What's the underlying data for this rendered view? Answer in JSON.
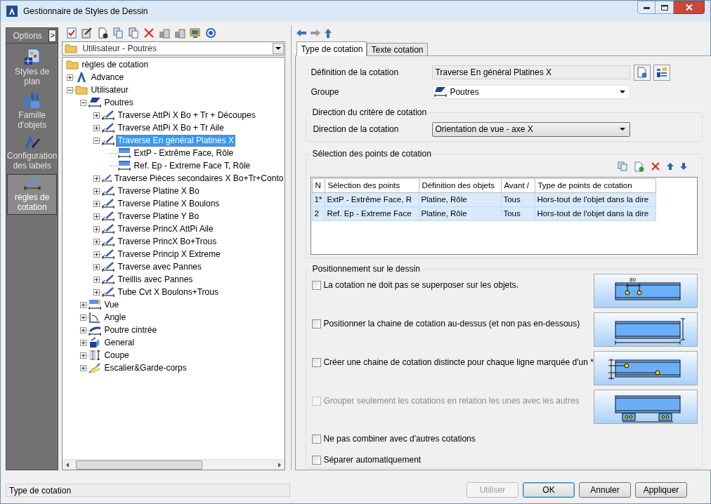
{
  "window": {
    "title": "Gestionnaire de Styles de Dessin"
  },
  "sidebar": {
    "header": "Options",
    "expand_button": ">",
    "items": [
      {
        "label": "Styles de plan",
        "kind": "plan",
        "selected": false
      },
      {
        "label": "Famille d'objets",
        "kind": "family",
        "selected": false
      },
      {
        "label": "Configuration des labels",
        "kind": "labels",
        "selected": false
      },
      {
        "label": "règles de cotation",
        "kind": "rules",
        "selected": true
      }
    ]
  },
  "tree_panel": {
    "filter": "Utilisateur - Poutres",
    "tree": [
      {
        "label": "règles de cotation",
        "kind": "folder",
        "selected": false,
        "children": [
          {
            "label": "Advance",
            "kind": "logo",
            "expanded": false,
            "selected": false
          },
          {
            "label": "Utilisateur",
            "kind": "folder",
            "expanded": true,
            "selected": false,
            "children": [
              {
                "label": "Poutres",
                "kind": "beam",
                "expanded": true,
                "selected": false,
                "children": [
                  {
                    "label": "Traverse AttPi X Bo + Tr + Découpes",
                    "kind": "rule",
                    "expanded": false,
                    "selected": false
                  },
                  {
                    "label": "Traverse AttPi X Bo + Tr Aile",
                    "kind": "rule",
                    "expanded": false,
                    "selected": false
                  },
                  {
                    "label": "Traverse En général Platines X",
                    "kind": "rule",
                    "expanded": true,
                    "selected": true,
                    "children": [
                      {
                        "label": "ExtP - Extrême Face, Rôle",
                        "kind": "point",
                        "selected": false
                      },
                      {
                        "label": "Ref. Ep - Extreme Face T, Rôle",
                        "kind": "point",
                        "selected": false
                      }
                    ]
                  },
                  {
                    "label": "Traverse Pièces secondaires X Bo+Tr+Conto",
                    "kind": "rule",
                    "expanded": false,
                    "selected": false
                  },
                  {
                    "label": "Traverse Platine X Bo",
                    "kind": "rule",
                    "expanded": false,
                    "selected": false
                  },
                  {
                    "label": "Traverse Platine X Boulons",
                    "kind": "rule",
                    "expanded": false,
                    "selected": false
                  },
                  {
                    "label": "Traverse Platine Y Bo",
                    "kind": "rule",
                    "expanded": false,
                    "selected": false
                  },
                  {
                    "label": "Traverse PrincX AttPi Aile",
                    "kind": "rule",
                    "expanded": false,
                    "selected": false
                  },
                  {
                    "label": "Traverse PrincX Bo+Trous",
                    "kind": "rule",
                    "expanded": false,
                    "selected": false
                  },
                  {
                    "label": "Traverse Princip X Extreme",
                    "kind": "rule",
                    "expanded": false,
                    "selected": false
                  },
                  {
                    "label": "Traverse avec Pannes",
                    "kind": "rule",
                    "expanded": false,
                    "selected": false
                  },
                  {
                    "label": "Treillis avec Pannes",
                    "kind": "rule",
                    "expanded": false,
                    "selected": false
                  },
                  {
                    "label": "Tube Cvt X Boulons+Trous",
                    "kind": "rule",
                    "expanded": false,
                    "selected": false
                  }
                ]
              },
              {
                "label": "Vue",
                "kind": "view",
                "expanded": false,
                "selected": false
              },
              {
                "label": "Angle",
                "kind": "angle",
                "expanded": false,
                "selected": false
              },
              {
                "label": "Poutre cintrée",
                "kind": "curved",
                "expanded": false,
                "selected": false
              },
              {
                "label": "General",
                "kind": "general",
                "expanded": false,
                "selected": false
              },
              {
                "label": "Coupe",
                "kind": "section",
                "expanded": false,
                "selected": false
              },
              {
                "label": "Escalier&Garde-corps",
                "kind": "stair",
                "expanded": false,
                "selected": false
              }
            ]
          }
        ]
      }
    ]
  },
  "tabs": [
    {
      "label": "Type de cotation",
      "selected": true
    },
    {
      "label": "Texte cotation",
      "selected": false
    }
  ],
  "definition": {
    "label": "Définition de la cotation",
    "value": "Traverse En général Platines X"
  },
  "group": {
    "label": "Groupe",
    "value": "Poutres"
  },
  "direction_section": {
    "title": "Direction du critère de cotation",
    "label": "Direction de la cotation",
    "value": "Orientation de vue - axe X"
  },
  "points_section": {
    "title": "Sélection des points de cotation",
    "table": {
      "columns": [
        "N",
        "Sélection des points",
        "Définition des objets",
        "Avant /",
        "Type de points de cotation"
      ],
      "rows": [
        {
          "cells": [
            "1*",
            "ExtP - Extrême Face, R",
            "Platine, Rôle",
            "Tous",
            "Hors-tout de l'objet dans la dire"
          ],
          "selected": true
        },
        {
          "cells": [
            "2",
            "Ref. Ep - Extreme Face",
            "Platine, Rôle",
            "Tous",
            "Hors-tout de l'objet dans la dire"
          ],
          "selected": true
        }
      ]
    }
  },
  "positioning_section": {
    "title": "Positionnement sur le dessin",
    "options": [
      {
        "label": "La cotation ne doit pas se superposer sur les objets.",
        "checked": false,
        "disabled": false,
        "preview": {
          "kind": "holes",
          "label": "80"
        }
      },
      {
        "label": "Positionner la chaine de cotation au-dessus (et non pas en-dessous)",
        "checked": false,
        "disabled": false,
        "preview": {
          "kind": "outside"
        }
      },
      {
        "label": "Créer une chaine de cotation distincte pour chaque ligne marquée d'un *",
        "checked": false,
        "disabled": false,
        "preview": {
          "kind": "chains"
        }
      },
      {
        "label": "Grouper seulement les cotations en relation les unes avec les autres",
        "checked": false,
        "disabled": true,
        "preview": {
          "kind": "grouped"
        }
      },
      {
        "label": "Ne pas combiner avec d'autres cotations",
        "checked": false,
        "disabled": false
      },
      {
        "label": "Séparer automatiquement",
        "checked": false,
        "disabled": false
      }
    ]
  },
  "buttons": [
    {
      "label": "Utiliser",
      "disabled": true,
      "default": false
    },
    {
      "label": "OK",
      "disabled": false,
      "default": true
    },
    {
      "label": "Annuler",
      "disabled": false,
      "default": false
    },
    {
      "label": "Appliquer",
      "disabled": false,
      "default": false
    }
  ],
  "status_bar": {
    "text": "Type de cotation"
  }
}
